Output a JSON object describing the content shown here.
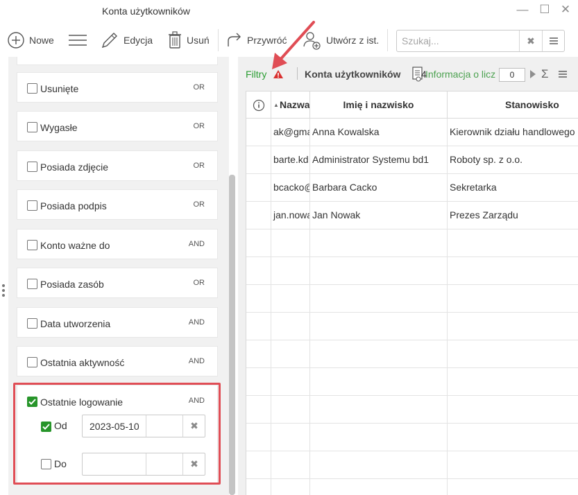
{
  "window": {
    "title": "Konta użytkowników"
  },
  "toolbar": {
    "new_label": "Nowe",
    "edit_label": "Edycja",
    "delete_label": "Usuń",
    "restore_label": "Przywróć",
    "create_from_label": "Utwórz z ist."
  },
  "search": {
    "placeholder": "Szukaj..."
  },
  "filters": {
    "items": [
      {
        "label": "Usunięte",
        "op": "OR",
        "checked": false
      },
      {
        "label": "Wygasłe",
        "op": "OR",
        "checked": false
      },
      {
        "label": "Posiada zdjęcie",
        "op": "OR",
        "checked": false
      },
      {
        "label": "Posiada podpis",
        "op": "OR",
        "checked": false
      },
      {
        "label": "Konto ważne do",
        "op": "AND",
        "checked": false
      },
      {
        "label": "Posiada zasób",
        "op": "OR",
        "checked": false
      },
      {
        "label": "Data utworzenia",
        "op": "AND",
        "checked": false
      },
      {
        "label": "Ostatnia aktywność",
        "op": "AND",
        "checked": false
      }
    ],
    "last_login": {
      "label": "Ostatnie logowanie",
      "op": "AND",
      "checked": true,
      "from_label": "Od",
      "from_checked": true,
      "from_value": "2023-05-10",
      "to_label": "Do",
      "to_checked": false,
      "to_value": ""
    }
  },
  "right": {
    "filters_label": "Filtry",
    "title": "Konta użytkowników",
    "count": "4",
    "pager_text": "Informacja o licz",
    "page_value": "0"
  },
  "grid": {
    "headers": [
      "Nazwa",
      "Imię i nazwisko",
      "Stanowisko"
    ],
    "rows": [
      {
        "login": "ak@gmail.com",
        "name": "Anna Kowalska",
        "position": "Kierownik działu handlowego"
      },
      {
        "login": "barte.kd",
        "name": "Administrator Systemu bd1",
        "position": "Roboty sp. z o.o."
      },
      {
        "login": "bcacko@",
        "name": "Barbara Cacko",
        "position": "Sekretarka"
      },
      {
        "login": "jan.nowak",
        "name": "Jan Nowak",
        "position": "Prezes Zarządu"
      }
    ]
  },
  "colors": {
    "accent_green": "#27952a",
    "highlight_red": "#e04d55"
  }
}
